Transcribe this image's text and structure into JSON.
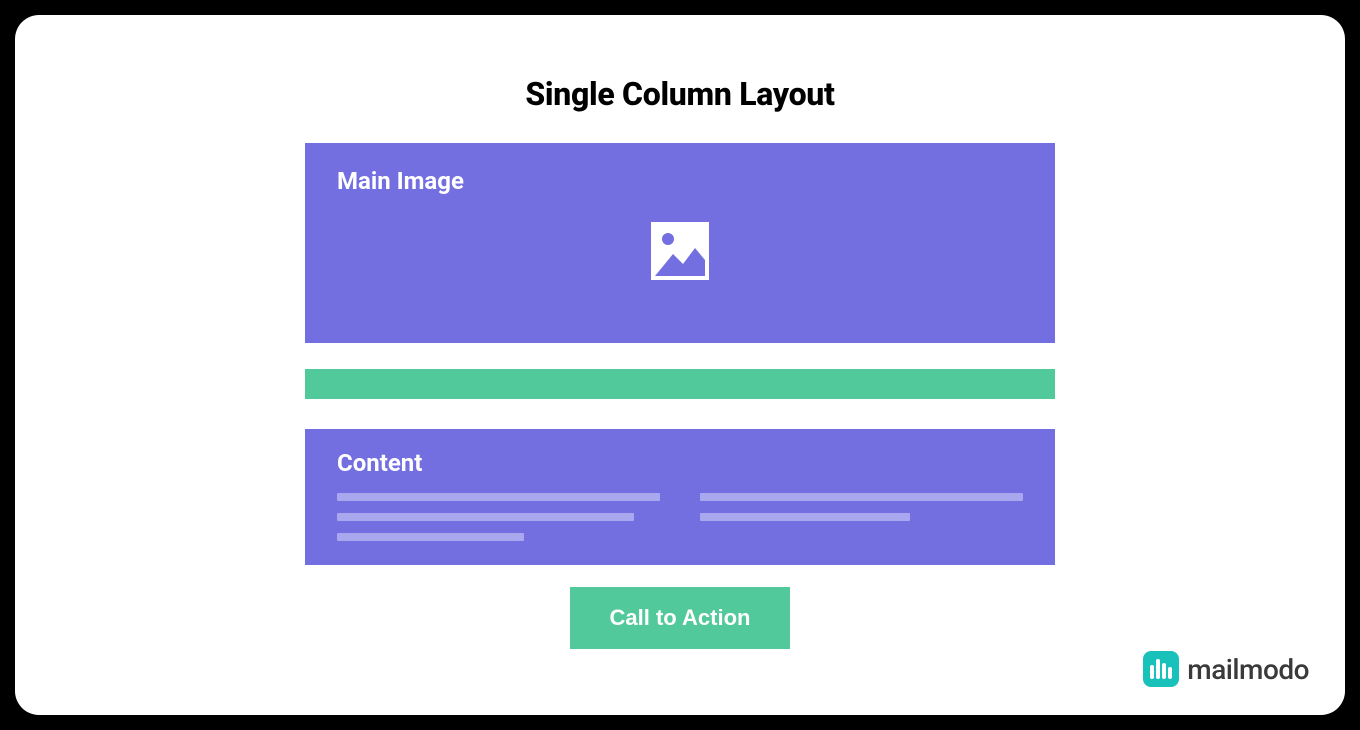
{
  "title": "Single Column Layout",
  "sections": {
    "main_image_label": "Main Image",
    "content_label": "Content",
    "cta_label": "Call to Action"
  },
  "brand": {
    "name": "mailmodo"
  },
  "colors": {
    "purple": "#736FE0",
    "purple_light": "#A9A7EE",
    "green": "#52C99A",
    "teal": "#18C1B9"
  }
}
